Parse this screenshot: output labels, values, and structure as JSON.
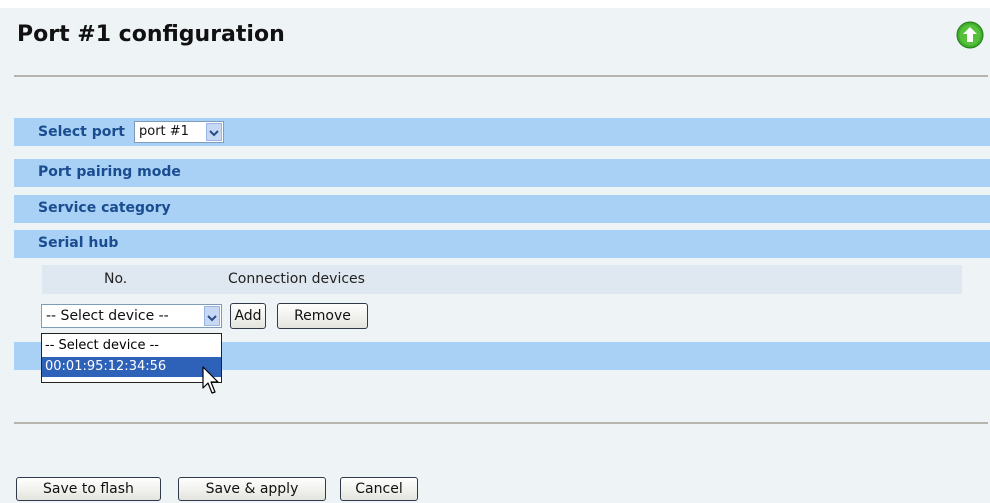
{
  "page": {
    "title": "Port #1 configuration",
    "up_icon": "arrow-up-circle-icon",
    "accent": "#a9d0f5",
    "label_color": "#1a4d8f"
  },
  "port_select": {
    "label": "Select port",
    "value": "port #1"
  },
  "sections": {
    "pairing": "Port pairing mode",
    "service": "Service category",
    "hub": "Serial hub"
  },
  "hub_table": {
    "col_no": "No.",
    "col_devices": "Connection devices"
  },
  "device_select": {
    "value": "-- Select device --",
    "options": [
      "-- Select device --",
      "00:01:95:12:34:56"
    ],
    "highlighted": "00:01:95:12:34:56"
  },
  "hub_buttons": {
    "add": "Add",
    "remove": "Remove"
  },
  "footer": {
    "save_flash": "Save to flash",
    "save_apply": "Save & apply",
    "cancel": "Cancel"
  }
}
